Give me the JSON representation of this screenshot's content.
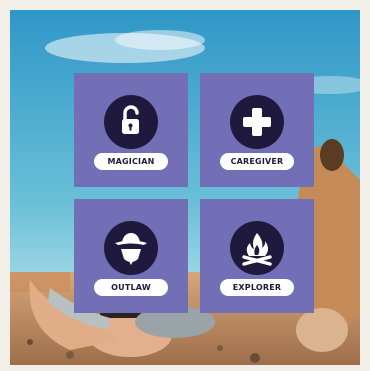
{
  "archetypes": [
    {
      "label": "MAGICIAN",
      "icon": "unlocked-padlock-icon"
    },
    {
      "label": "CAREGIVER",
      "icon": "plus-cross-icon"
    },
    {
      "label": "OUTLAW",
      "icon": "masked-bandit-icon"
    },
    {
      "label": "EXPLORER",
      "icon": "campfire-icon"
    }
  ],
  "colors": {
    "tile": "#736fb6",
    "icon_disc": "#1f1a3d",
    "pill": "#ffffff",
    "sky_top": "#2f97c7",
    "sky_bottom": "#a8dbe6",
    "sand": "#c9956a"
  },
  "background": {
    "description_icon": "desert-photo-background"
  }
}
